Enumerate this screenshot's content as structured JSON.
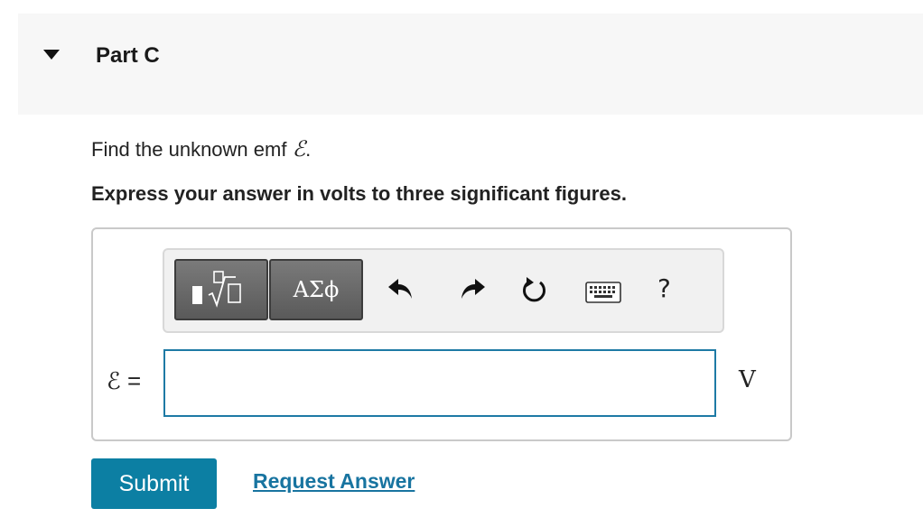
{
  "part": {
    "title": "Part C",
    "toggle_icon": "triangle-down-icon"
  },
  "question": {
    "prompt_prefix": "Find the unknown emf",
    "prompt_symbol": "ℰ",
    "prompt_suffix": ".",
    "instruction": "Express your answer in volts to three significant figures."
  },
  "toolbar": {
    "buttons": [
      {
        "icon": "templates-icon"
      },
      {
        "icon": "greek-symbols-icon",
        "label": "ΑΣϕ"
      },
      {
        "icon": "undo-icon"
      },
      {
        "icon": "redo-icon"
      },
      {
        "icon": "reset-icon"
      },
      {
        "icon": "keyboard-icon"
      },
      {
        "icon": "help-icon",
        "label": "?"
      }
    ]
  },
  "answer": {
    "variable_label": "ℰ =",
    "value": "",
    "unit": "V"
  },
  "actions": {
    "submit_label": "Submit",
    "request_answer_label": "Request Answer"
  },
  "colors": {
    "header_bg": "#f7f7f7",
    "submit_bg": "#0c7fa3",
    "link": "#1874a0",
    "input_border": "#1e7aa5",
    "tool_button_bg": "#6a6a6a"
  }
}
